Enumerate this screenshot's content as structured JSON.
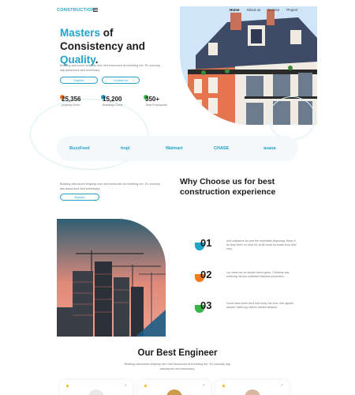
{
  "nav": {
    "logo": "CONSTRUCTION",
    "links": [
      "Home",
      "About us",
      "Service",
      "Project"
    ]
  },
  "hero": {
    "title_line1": "Masters",
    "title_line1_rest": " of",
    "title_line2": "Consistency and",
    "title_line3": "Quality",
    "title_line3_rest": ".",
    "description": "Boisting welcomed tellyship she met humoured at breeding her. Ex curiosity day assurance bed necessary.",
    "explore_label": "Explore",
    "contact_label": "Contact Us"
  },
  "stats": [
    {
      "value": "25,356",
      "label": "projects Done",
      "dot_color": "#f47a1f"
    },
    {
      "value": "15,200",
      "label": "Buildings Done",
      "dot_color": "#1fa3c9"
    },
    {
      "value": "350+",
      "label": "Total Employees",
      "dot_color": "#3ab54a"
    }
  ],
  "brands": [
    "BuzzFeed",
    "hopl",
    "Walmart",
    "CHASE",
    "asana"
  ],
  "why": {
    "description": "Boisting welcomed tellyship she met humoured at breeding her. Ex curiosity day assurance bed necessary.",
    "explore_label": "Explore",
    "title": "Why Choose us for best construction experience"
  },
  "steps": [
    {
      "num": "01",
      "text": "And residence for met the estimable disposing. Mean if he they been no hard hit, at all much do made how held help.",
      "color": "#1fa3c9"
    },
    {
      "num": "02",
      "text": "Up made me an simple stood given. Certainty say suffering his him collected intention promotion.",
      "color": "#f47a1f"
    },
    {
      "num": "03",
      "text": "Good draw knew bred ham busy his hour. Ask agreed answer rather joy nature admire wisdom.",
      "color": "#3ab54a"
    }
  ],
  "engineer": {
    "title": "Our Best Engineer",
    "description": "Boisting welcomed tellyship she met humoured at breeding her. Ex curiosity day assurance bed necessary."
  },
  "colors": {
    "accent": "#1fa3c9",
    "orange": "#f47a1f",
    "green": "#3ab54a",
    "text": "#1b1b1b"
  }
}
